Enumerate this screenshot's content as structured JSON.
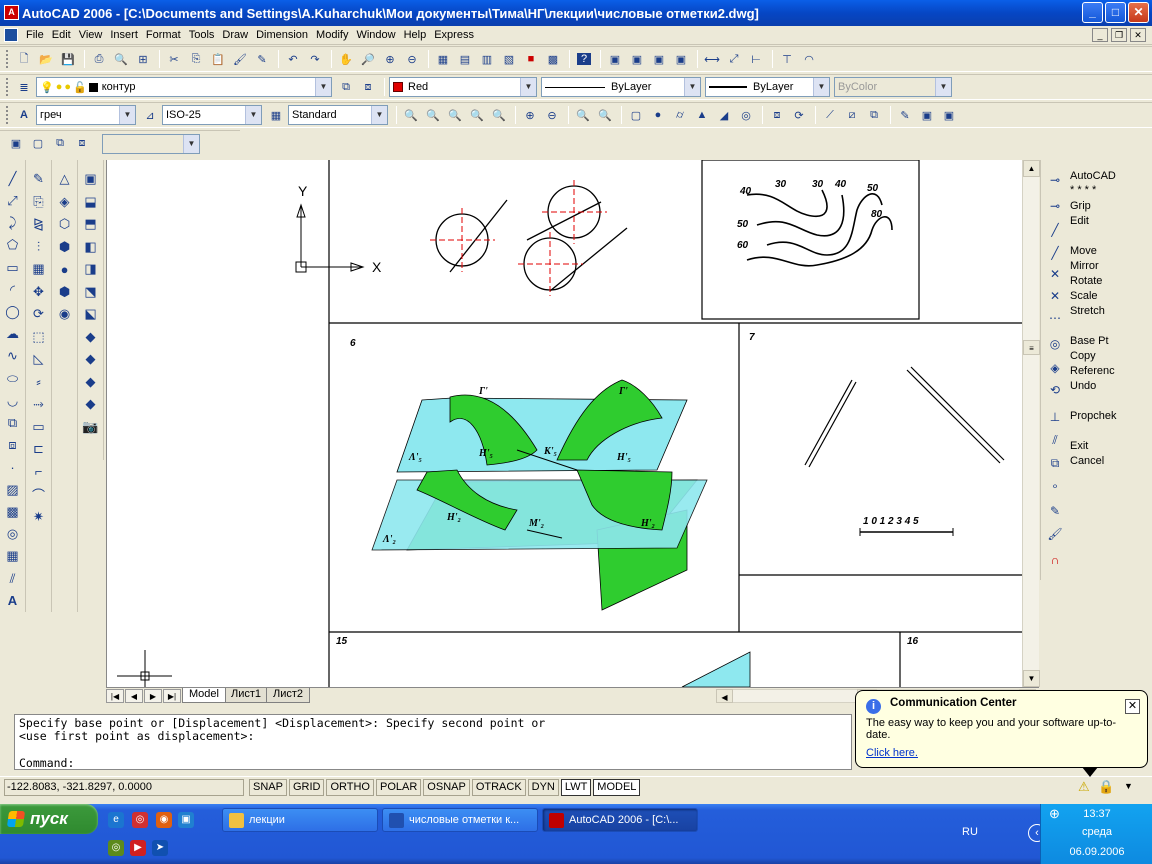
{
  "window": {
    "title": "AutoCAD 2006 - [C:\\Documents and Settings\\A.Kuharchuk\\Мои документы\\Тима\\НГ\\лекции\\числовые отметки2.dwg]",
    "minimize": "_",
    "maximize": "□",
    "close": "✕"
  },
  "menu": [
    "File",
    "Edit",
    "View",
    "Insert",
    "Format",
    "Tools",
    "Draw",
    "Dimension",
    "Modify",
    "Window",
    "Help",
    "Express"
  ],
  "layers_toolbar": {
    "layer_name": "контур",
    "color": "Red",
    "linetype": "ByLayer",
    "lineweight": "ByLayer",
    "plotstyle": "ByColor",
    "accent_color": "#e00000"
  },
  "styles_toolbar": {
    "text_style": "греч",
    "dim_style": "ISO-25",
    "table_style": "Standard"
  },
  "drawing": {
    "ucs_y": "Y",
    "ucs_x": "X",
    "panel_labels": [
      "6",
      "7",
      "15",
      "16"
    ],
    "contour_labels": [
      "30",
      "30",
      "40",
      "50",
      "40",
      "80",
      "50",
      "60"
    ],
    "scale_label": "1 0 1 2 3 4 5",
    "surface_labels": [
      "Г'",
      "Г'",
      "Λ'₅",
      "Н'₅",
      "К'₅",
      "Н'₅",
      "Н'₂",
      "М'₂",
      "Н'₂",
      "Λ'₂"
    ],
    "fill_green": "#2fcc2f",
    "fill_cyan": "#8ee8ef"
  },
  "right_toolbar": [
    {
      "label": "AutoCAD",
      "icon": "move-icon"
    },
    {
      "label": "* * * *",
      "icon": ""
    },
    {
      "label": "Grip",
      "icon": "grip-icon"
    },
    {
      "label": " Edit",
      "icon": ""
    },
    {
      "label": "Move",
      "icon": "move-icon"
    },
    {
      "label": "Mirror",
      "icon": "mirror-icon"
    },
    {
      "label": "Rotate",
      "icon": "rotate-icon"
    },
    {
      "label": "Scale",
      "icon": "scale-icon"
    },
    {
      "label": "Stretch",
      "icon": "stretch-icon"
    },
    {
      "label": "Base Pt",
      "icon": "basept-icon"
    },
    {
      "label": "Copy",
      "icon": ""
    },
    {
      "label": "Referenc",
      "icon": ""
    },
    {
      "label": "Undo",
      "icon": "undo-icon"
    },
    {
      "label": "Propchek",
      "icon": "propchek-icon"
    },
    {
      "label": "Exit",
      "icon": "exit-icon"
    },
    {
      "label": "Cancel",
      "icon": "cancel-icon"
    }
  ],
  "tabs": [
    "Model",
    "Лист1",
    "Лист2"
  ],
  "command": {
    "line1": "Specify base point or [Displacement] <Displacement>: Specify second point or",
    "line2": "<use first point as displacement>:",
    "prompt": "Command:"
  },
  "status": {
    "coords": "-122.8083, -321.8297, 0.0000",
    "toggles": [
      "SNAP",
      "GRID",
      "ORTHO",
      "POLAR",
      "OSNAP",
      "OTRACK",
      "DYN",
      "LWT",
      "MODEL"
    ]
  },
  "comm_center": {
    "title": "Communication Center",
    "body": "The easy way to keep you and your software up-to-date.",
    "link": "Click here."
  },
  "taskbar": {
    "start": "пуск",
    "tasks": [
      "лекции",
      "числовые отметки к...",
      "AutoCAD 2006 - [C:\\..."
    ],
    "lang": "RU",
    "time": "13:37",
    "day": "среда",
    "date": "06.09.2006"
  }
}
